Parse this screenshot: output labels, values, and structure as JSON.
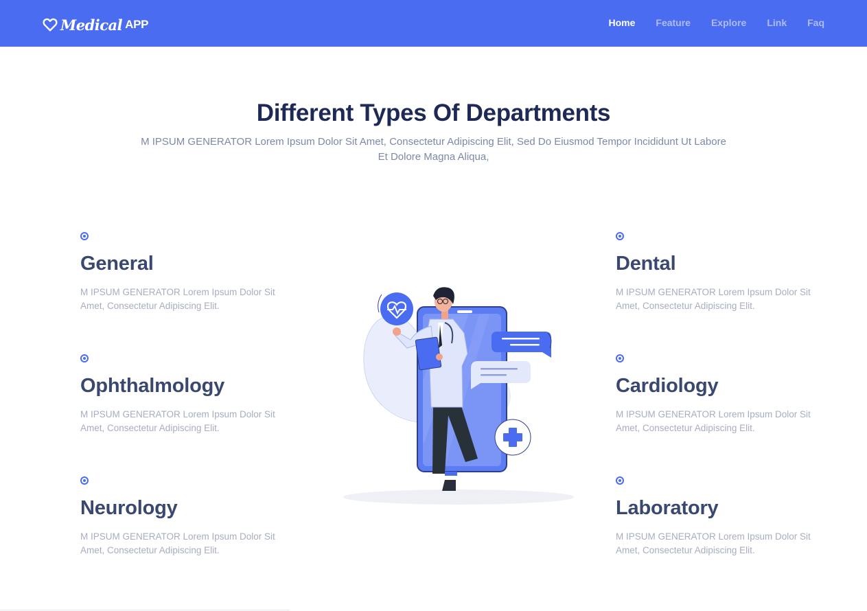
{
  "header": {
    "brand_name": "Medical",
    "brand_suffix": "APP",
    "brand_icon": "heart-outline-icon",
    "nav": [
      {
        "label": "Home",
        "active": true
      },
      {
        "label": "Feature",
        "active": false
      },
      {
        "label": "Explore",
        "active": false
      },
      {
        "label": "Link",
        "active": false
      },
      {
        "label": "Faq",
        "active": false
      }
    ]
  },
  "section": {
    "title": "Different Types Of Departments",
    "subtitle": "M IPSUM GENERATOR Lorem Ipsum Dolor Sit Amet, Consectetur Adipiscing Elit, Sed Do Eiusmod Tempor Incididunt Ut Labore Et Dolore Magna Aliqua,"
  },
  "departments_left": [
    {
      "name": "General",
      "desc": "M IPSUM GENERATOR Lorem Ipsum Dolor Sit Amet, Consectetur Adipiscing Elit."
    },
    {
      "name": "Ophthalmology",
      "desc": "M IPSUM GENERATOR Lorem Ipsum Dolor Sit Amet, Consectetur Adipiscing Elit."
    },
    {
      "name": "Neurology",
      "desc": "M IPSUM GENERATOR Lorem Ipsum Dolor Sit Amet, Consectetur Adipiscing Elit."
    }
  ],
  "departments_right": [
    {
      "name": "Dental",
      "desc": "M IPSUM GENERATOR Lorem Ipsum Dolor Sit Amet, Consectetur Adipiscing Elit."
    },
    {
      "name": "Cardiology",
      "desc": "M IPSUM GENERATOR Lorem Ipsum Dolor Sit Amet, Consectetur Adipiscing Elit."
    },
    {
      "name": "Laboratory",
      "desc": "M IPSUM GENERATOR Lorem Ipsum Dolor Sit Amet, Consectetur Adipiscing Elit."
    }
  ],
  "colors": {
    "accent": "#4a6cf0",
    "heading": "#1e2a55",
    "dept_title": "#3a4870",
    "muted": "#a7adc2"
  },
  "icons": {
    "dept_bullet": "radio-dot-icon",
    "illustration": "doctor-phone-illustration"
  }
}
